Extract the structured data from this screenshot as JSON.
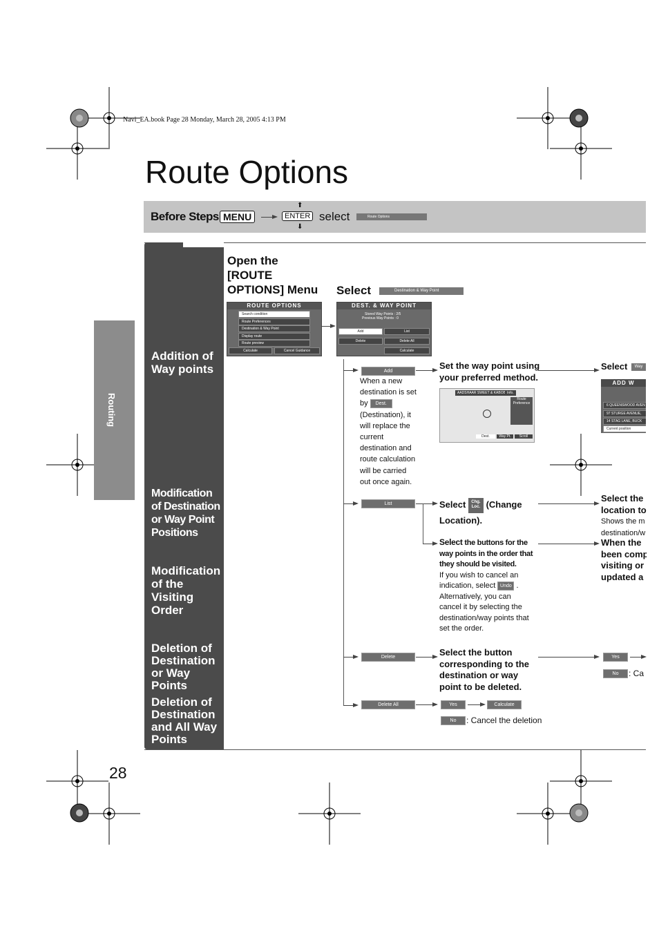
{
  "header_line": "Navi_EA.book  Page 28  Monday, March 28, 2005  4:13 PM",
  "title": "Route Options",
  "before_steps": {
    "label": "Before Steps",
    "menu_key": "MENU",
    "enter_key": "ENTER",
    "select": "select",
    "menu_item": "Route Options"
  },
  "side_tab": "Routing",
  "page_number": "28",
  "sections": [
    "Addition of Way points",
    "Modification of Destination or Way Point Positions",
    "Modification of the Visiting Order",
    "Deletion of Destination or Way Points",
    "Deletion of Destination and All Way Points"
  ],
  "step1": {
    "title": "Open the [ROUTE OPTIONS] Menu",
    "screen": {
      "title": "ROUTE OPTIONS",
      "items": [
        "Search condition",
        "Route Preferences",
        "Destination & Way Point",
        "Display route",
        "Route preview"
      ],
      "buttons": [
        "Calculate",
        "Cancel Guidance"
      ]
    }
  },
  "step2": {
    "select": "Select",
    "button": "Destination & Way Point",
    "screen": {
      "title": "DEST. & WAY POINT",
      "stored": "Stored Way Points :   2/5",
      "previous": "Previous Way Points :   0",
      "buttons": [
        "Add",
        "List",
        "Delete",
        "Delete All",
        "Calculate"
      ]
    }
  },
  "add": {
    "button": "Add",
    "note_lines": [
      "When a new",
      "destination is set",
      "by"
    ],
    "dest_button": "Dest.",
    "note_lines2": [
      "(Destination), it",
      "will replace the",
      "current",
      "destination and",
      "route calculation",
      "will be carried",
      "out once again."
    ],
    "step": "Set the way point using your preferred method.",
    "map": {
      "place": "AADSHAAR SWEET & KABOB",
      "info": "Info.",
      "route_pref": "Route Preference",
      "buttons": [
        "Dest.",
        "Way Pt.",
        "Scroll"
      ]
    },
    "next_select": "Select",
    "next_button": "Way",
    "add_screen": {
      "title": "ADD W",
      "items": [
        "6 QUEENSWOOD AVEN",
        "97 STURGE AVENUE,",
        "14 STAG LANE, BUCK"
      ],
      "current": "Current position"
    }
  },
  "list": {
    "button": "List",
    "select": "Select",
    "chg_icon": "Chg. Loc.",
    "change": "(Change Location).",
    "right1": [
      "Select the",
      "location to",
      "Shows the m",
      "destination/w"
    ],
    "order_bold": "Select",
    "order_text": "the buttons for the way points in the order that they should be visited.",
    "cancel_lines": [
      "If you wish to cancel an",
      "indication, select"
    ],
    "undo": "Undo",
    "cancel_lines2": [
      "Alternatively, you can",
      "cancel it by selecting the",
      "destination/way points that",
      "set the order."
    ],
    "right2": [
      "When the",
      "been comp",
      "visiting or",
      "updated a"
    ]
  },
  "delete": {
    "button": "Delete",
    "step": "Select the button corresponding to the destination or way point to be deleted.",
    "yes": "Yes",
    "no": "No",
    "no_text": ":  Ca"
  },
  "delete_all": {
    "button": "Delete All",
    "yes": "Yes",
    "calculate": "Calculate",
    "no": "No",
    "no_text": ":  Cancel the deletion"
  }
}
